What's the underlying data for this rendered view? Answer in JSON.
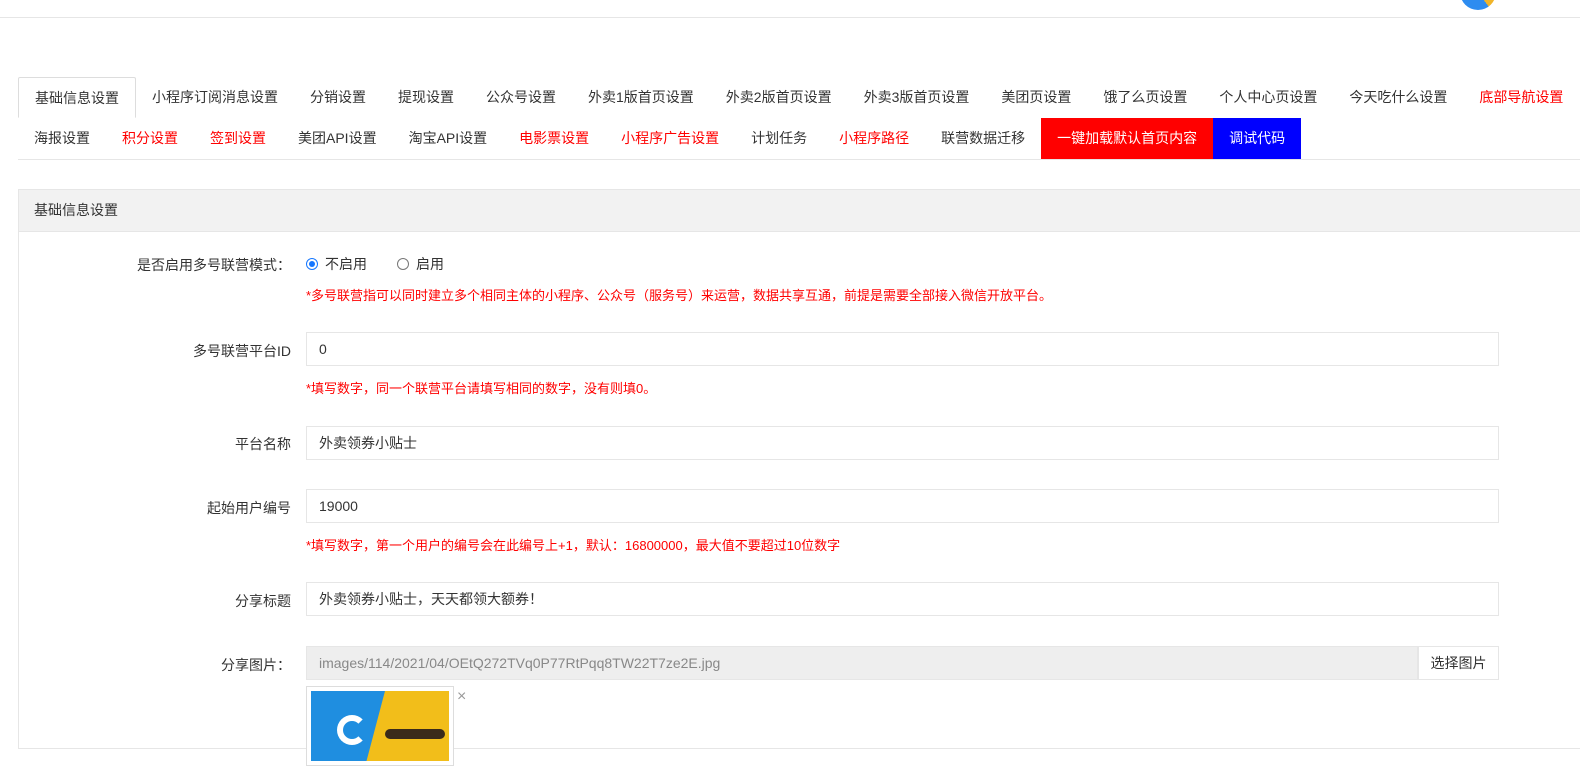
{
  "tabs": {
    "row1": [
      {
        "label": "基础信息设置",
        "style": "active"
      },
      {
        "label": "小程序订阅消息设置",
        "style": "normal"
      },
      {
        "label": "分销设置",
        "style": "normal"
      },
      {
        "label": "提现设置",
        "style": "normal"
      },
      {
        "label": "公众号设置",
        "style": "normal"
      },
      {
        "label": "外卖1版首页设置",
        "style": "normal"
      },
      {
        "label": "外卖2版首页设置",
        "style": "normal"
      },
      {
        "label": "外卖3版首页设置",
        "style": "normal"
      },
      {
        "label": "美团页设置",
        "style": "normal"
      },
      {
        "label": "饿了么页设置",
        "style": "normal"
      },
      {
        "label": "个人中心页设置",
        "style": "normal"
      },
      {
        "label": "今天吃什么设置",
        "style": "normal"
      },
      {
        "label": "底部导航设置",
        "style": "red"
      }
    ],
    "row2": [
      {
        "label": "海报设置",
        "style": "normal"
      },
      {
        "label": "积分设置",
        "style": "red"
      },
      {
        "label": "签到设置",
        "style": "red"
      },
      {
        "label": "美团API设置",
        "style": "normal"
      },
      {
        "label": "淘宝API设置",
        "style": "normal"
      },
      {
        "label": "电影票设置",
        "style": "red"
      },
      {
        "label": "小程序广告设置",
        "style": "red"
      },
      {
        "label": "计划任务",
        "style": "normal"
      },
      {
        "label": "小程序路径",
        "style": "red"
      },
      {
        "label": "联营数据迁移",
        "style": "normal"
      },
      {
        "label": "一键加载默认首页内容",
        "style": "btn-red"
      },
      {
        "label": "调试代码",
        "style": "btn-blue"
      }
    ]
  },
  "panel": {
    "title": "基础信息设置",
    "multi_mode": {
      "label": "是否启用多号联营模式：",
      "options": [
        "不启用",
        "启用"
      ],
      "selected": "不启用",
      "hint": "*多号联营指可以同时建立多个相同主体的小程序、公众号（服务号）来运营，数据共享互通，前提是需要全部接入微信开放平台。"
    },
    "platform_id": {
      "label": "多号联营平台ID",
      "value": "0",
      "hint": "*填写数字，同一个联营平台请填写相同的数字，没有则填0。"
    },
    "platform_name": {
      "label": "平台名称",
      "value": "外卖领券小贴士"
    },
    "start_user_no": {
      "label": "起始用户编号",
      "value": "19000",
      "hint": "*填写数字，第一个用户的编号会在此编号上+1，默认：16800000，最大值不要超过10位数字"
    },
    "share_title": {
      "label": "分享标题",
      "value": "外卖领券小贴士，天天都领大额券！"
    },
    "share_image": {
      "label": "分享图片：",
      "value": "images/114/2021/04/OEtQ272TVq0P77RtPqq8TW22T7ze2E.jpg",
      "button": "选择图片",
      "remove": "×"
    }
  },
  "colors": {
    "accent_red": "#ff0000",
    "accent_blue": "#0000ff",
    "radio": "#1677ff"
  }
}
